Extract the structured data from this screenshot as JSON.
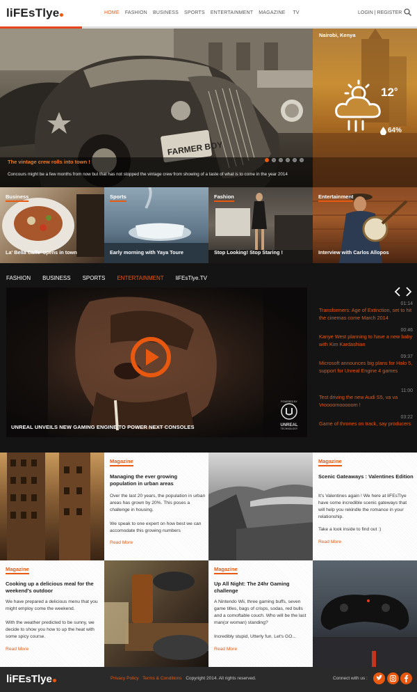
{
  "brand": {
    "logo": "liFEsTlye",
    "accent": "#e8580f"
  },
  "nav": {
    "items": [
      "HOME",
      "FASHION",
      "BUSINESS",
      "SPORTS",
      "ENTERTAINMENT",
      "MAGAZINE",
      "TV"
    ],
    "active": "HOME",
    "login": "LOGIN",
    "separator": "|",
    "register": "REGISTER",
    "search_icon": "search-icon"
  },
  "hero": {
    "title": "The vintage crew rolls into town !",
    "description": "Concours might be a few months from now but that has not  stopped the vintage crew from showing of  a taste of what is to come in the year 2014",
    "plate": "FARMER BOY"
  },
  "weather": {
    "city": "Nairobi, Kenya",
    "temp": "12",
    "unit": "°",
    "humidity": "64%",
    "icon": "rain-cloud-sun-icon"
  },
  "tiles": [
    {
      "category": "Business",
      "caption": "La' Bella Caffe' opens in town"
    },
    {
      "category": "Sports",
      "caption": "Early morning with Yaya Toure"
    },
    {
      "category": "Fashion",
      "caption": "Stop Looking! Stop Staring !"
    },
    {
      "category": "Entertainment",
      "caption": "Interview with Carlos Allopos"
    }
  ],
  "video_nav": {
    "items": [
      "FASHION",
      "BUSINESS",
      "SPORTS",
      "ENTERTAINMENT",
      "liFEsTlye.TV"
    ],
    "active": "ENTERTAINMENT"
  },
  "video": {
    "title": "UNREAL UNVEILS NEW GAMING ENGINE TO POWER NEXT CONSOLES",
    "badge_top": "POWERED BY",
    "badge_name": "UNREAL",
    "badge_sub": "TECHNOLOGY"
  },
  "news": [
    {
      "time": "01:14",
      "headline": "Transformers: Age of Extinction, set to hit the cinemas come March 2014"
    },
    {
      "time": "00:46",
      "headline": "Kanye West  planning to have a new baby with Kim Kardashian"
    },
    {
      "time": "09:37",
      "headline": "Microsoft announces big plans for Halo 5, support for Unreal Engine 4 games"
    },
    {
      "time": "11:00",
      "headline": "Test driving the  new Audi S5, va va Vroooomooooom !"
    },
    {
      "time": "03:22",
      "headline": "Game of thrones on track, say producers"
    }
  ],
  "cards": [
    {
      "category": "Magazine",
      "title": "Managing the ever growing population in urban areas",
      "body1": "Over the last 20 years, the population in urban areas has grown by 20%. This poses a challenge in housing.",
      "body2": "We speak to one expert on how best we can accomodate this growing numbers",
      "more": "Read More"
    },
    {
      "category": "Magazine",
      "title": "Scenic Gateaways : Valentines Edition",
      "body1": "It's Valentines again ! We here at liFEsTlye have some incredible scenic gateways that will help you rekindle the romance in your relationship.",
      "body2": "Take a look inside to find out :)",
      "more": "Read More"
    },
    {
      "category": "Magazine",
      "title": "Cooking up a delicious meal for the weekend's outdoor",
      "body1": "We have prepared a delicious menu that you might employ come the weekend.",
      "body2": "With the weather predicted to be sunny, we decide to show you how to up the heat with some spicy course.",
      "more": "Read More"
    },
    {
      "category": "Magazine",
      "title": "Up All Night: The 24hr Gaming challenge",
      "body1": "A Nintendo Wii, three gaming buffs, seven game titles, bags of crisps, sodas, red bulls and a comoftable couch. Who will be the last man(or woman) standing?",
      "body2": "Incredibly stupid, Utterly fun. Let's GO...",
      "more": "Read More"
    }
  ],
  "footer": {
    "logo": "liFEsTlye",
    "privacy": "Privacy Policy",
    "terms": "Terms & Conditions",
    "copyright": "Copyright 2014.  All rights reserved.",
    "connect": "Connect with us :",
    "social": [
      "twitter-icon",
      "instagram-icon",
      "facebook-icon"
    ]
  }
}
